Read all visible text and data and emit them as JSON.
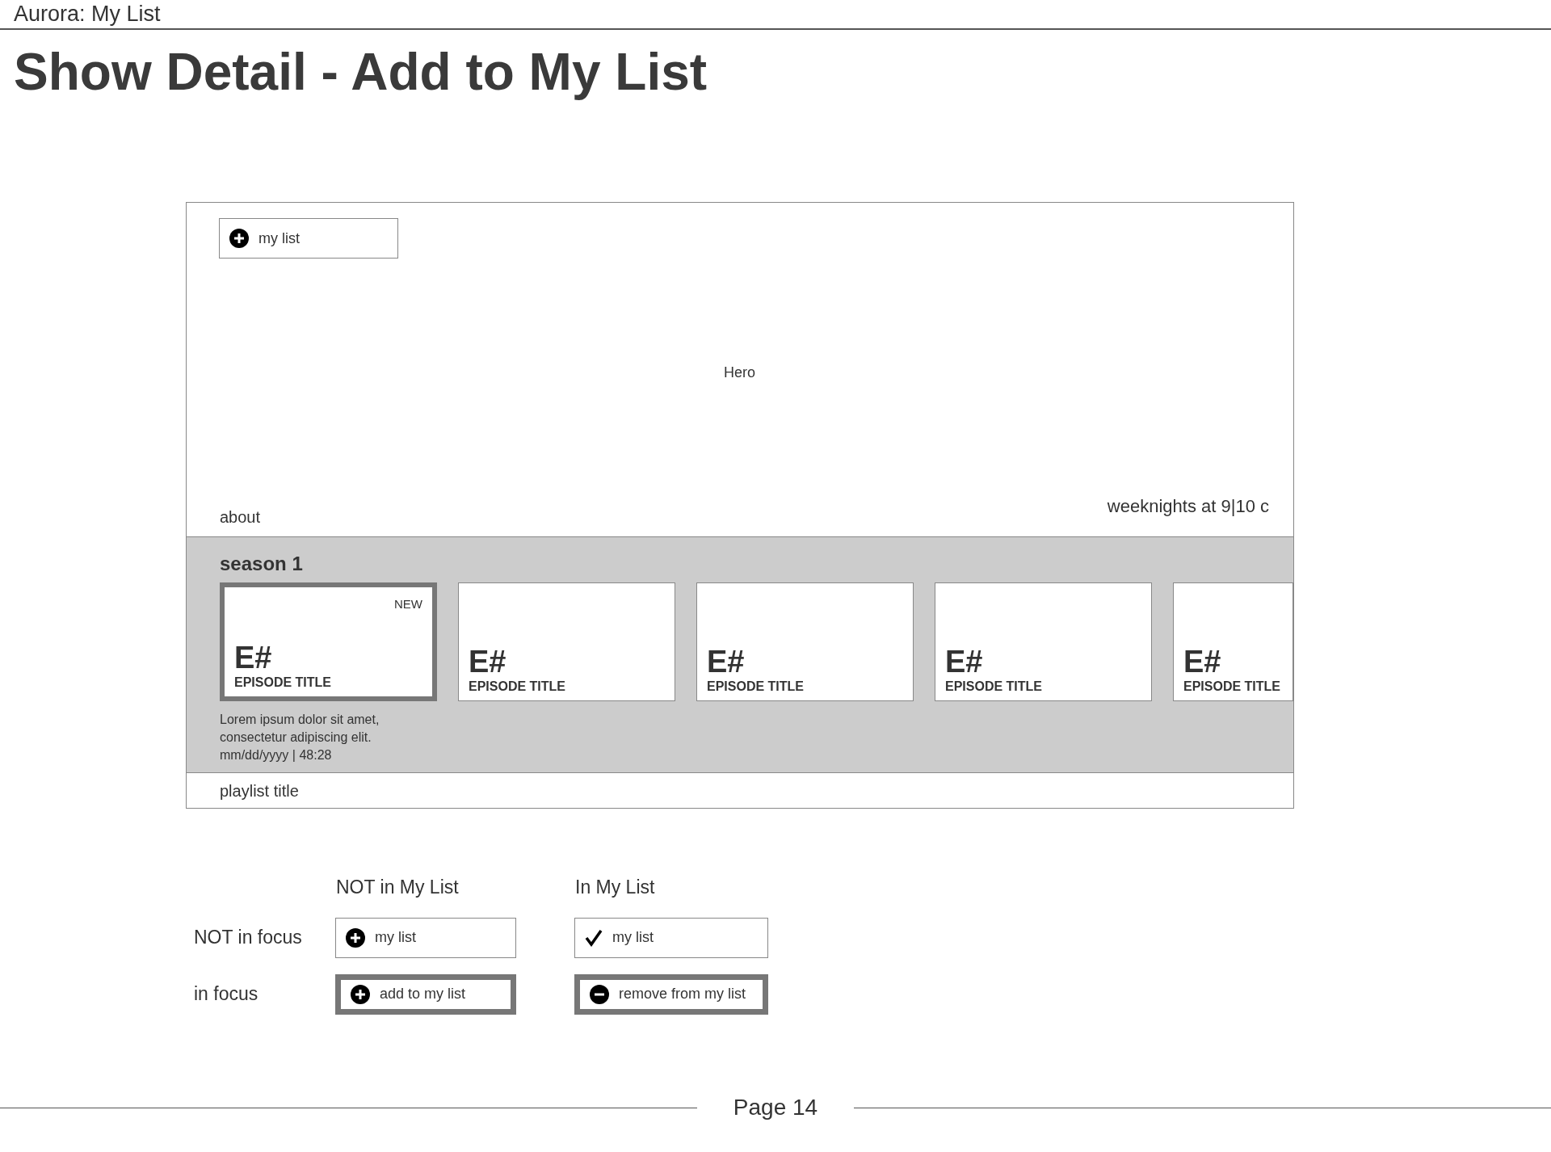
{
  "document": {
    "header": "Aurora: My List",
    "title": "Show Detail - Add to My List",
    "page": "Page 14"
  },
  "wireframe": {
    "hero_button": {
      "label": "my list",
      "kind": "plus",
      "focused": false
    },
    "hero_label": "Hero",
    "about": "about",
    "schedule": "weeknights at 9|10 c",
    "season": {
      "title": "season 1",
      "episodes": [
        {
          "number": "E#",
          "title": "EPISODE TITLE",
          "badge": "NEW",
          "focused": true
        },
        {
          "number": "E#",
          "title": "EPISODE TITLE",
          "focused": false
        },
        {
          "number": "E#",
          "title": "EPISODE TITLE",
          "focused": false
        },
        {
          "number": "E#",
          "title": "EPISODE TITLE",
          "focused": false
        },
        {
          "number": "E#",
          "title": "EPISODE TITLE",
          "focused": false
        }
      ],
      "description": "Lorem ipsum dolor sit amet, consectetur adipiscing elit.",
      "meta": "mm/dd/yyyy | 48:28"
    },
    "playlist_title": "playlist title"
  },
  "states": {
    "columns": [
      "NOT in My List",
      "In My List"
    ],
    "rows": [
      {
        "label": "NOT in focus",
        "buttons": [
          {
            "label": "my list",
            "kind": "plus",
            "focused": false
          },
          {
            "label": "my list",
            "kind": "check",
            "focused": false
          }
        ]
      },
      {
        "label": "in focus",
        "buttons": [
          {
            "label": "add to my list",
            "kind": "plus",
            "focused": true
          },
          {
            "label": "remove from my list",
            "kind": "minus",
            "focused": true
          }
        ]
      }
    ]
  }
}
